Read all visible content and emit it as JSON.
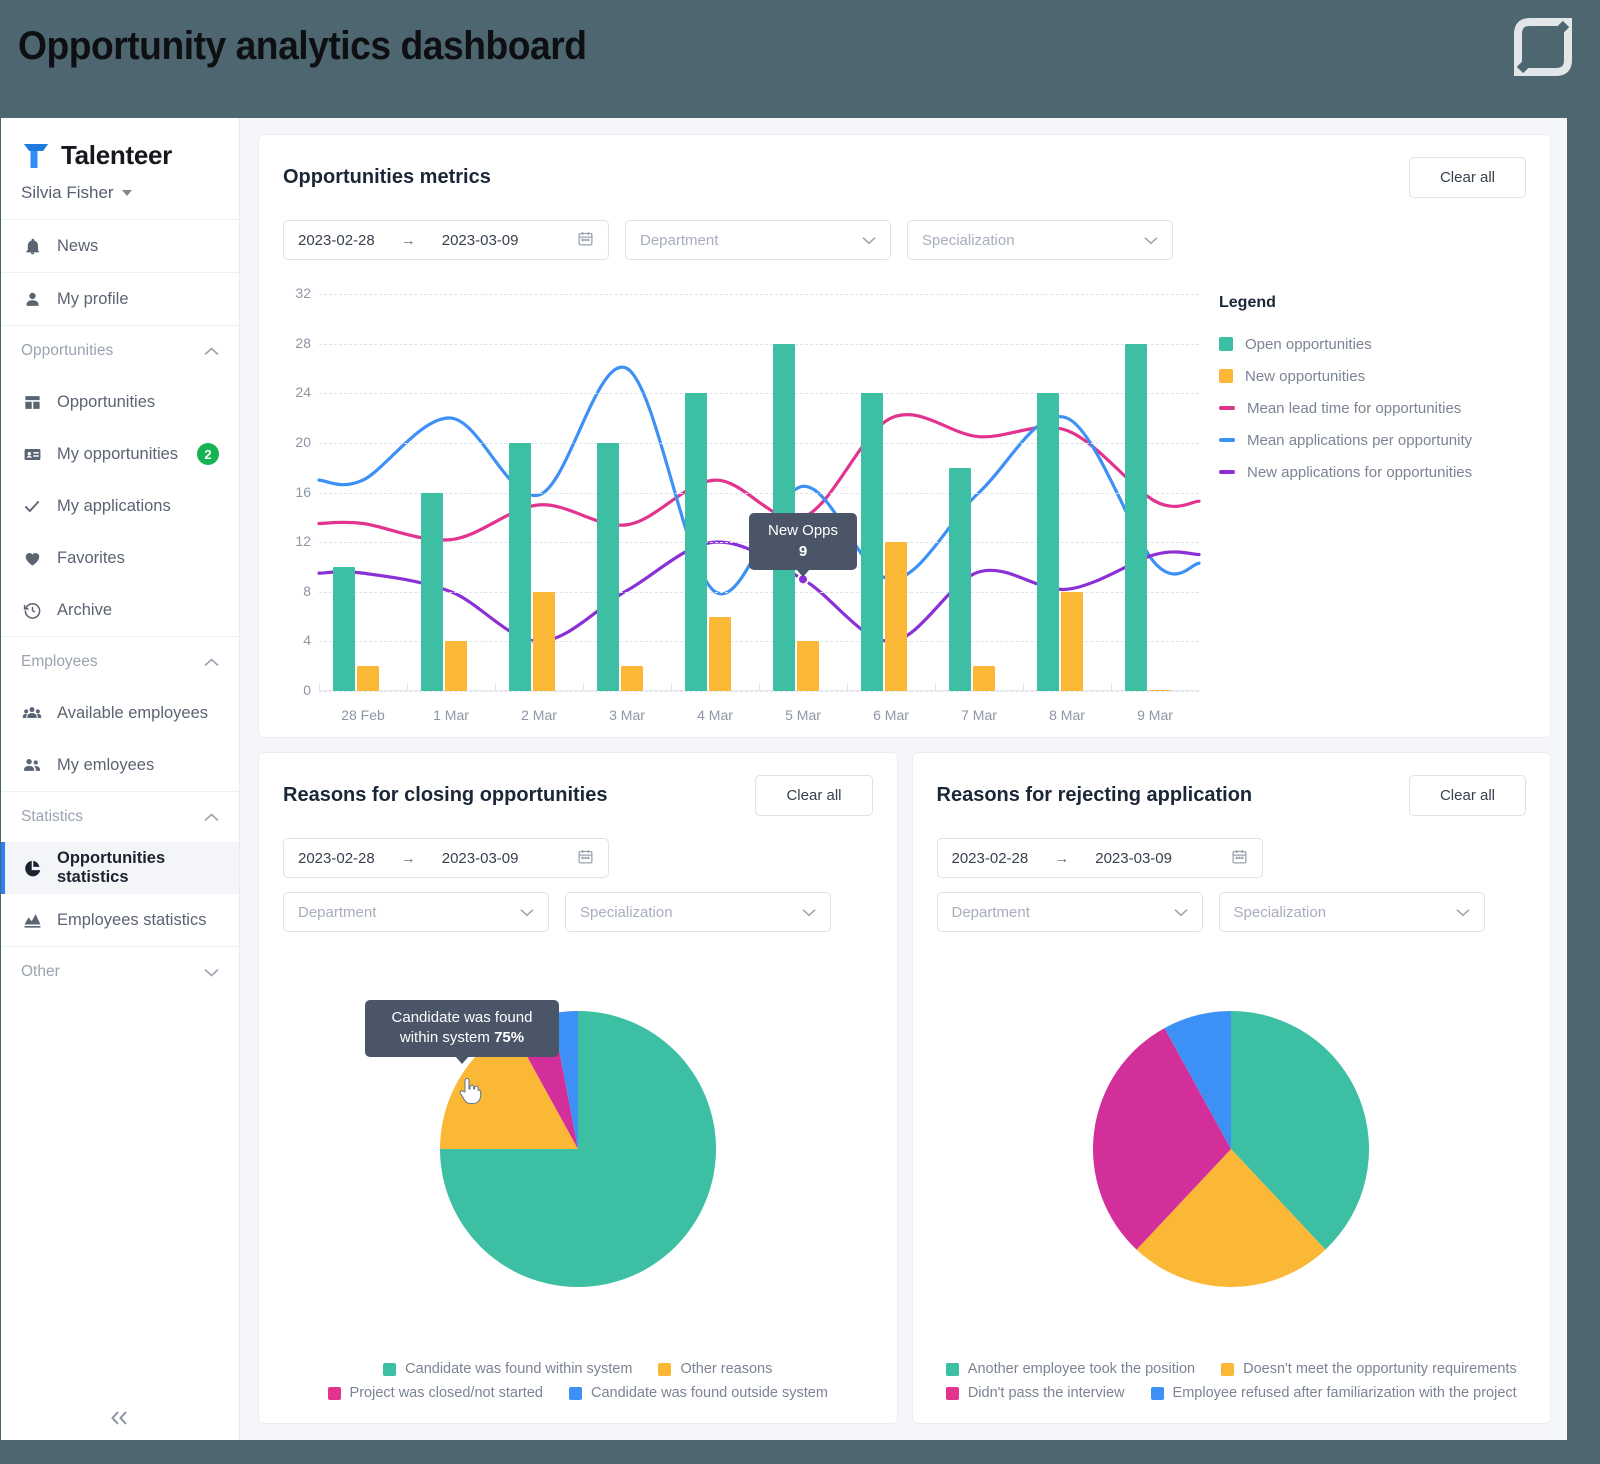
{
  "banner": {
    "title": "Opportunity analytics dashboard",
    "logo_icon": "leaf-logo-icon",
    "bg_color": "#4d6670"
  },
  "sidebar": {
    "brand": {
      "name": "Talenteer",
      "mark_icon": "talenteer-t-logo-icon",
      "mark_color": "#2d8cf5"
    },
    "user": {
      "name": "Silvia Fisher",
      "caret_icon": "caret-down-icon"
    },
    "top_items": [
      {
        "label": "News",
        "icon": "bell-icon"
      },
      {
        "label": "My profile",
        "icon": "person-icon"
      }
    ],
    "groups": [
      {
        "label": "Opportunities",
        "chevron": "chevron-up-icon",
        "items": [
          {
            "label": "Opportunities",
            "icon": "grid-table-icon",
            "badge": ""
          },
          {
            "label": "My opportunities",
            "icon": "id-card-icon",
            "badge": "2"
          },
          {
            "label": "My applications",
            "icon": "check-icon",
            "badge": ""
          },
          {
            "label": "Favorites",
            "icon": "heart-icon",
            "badge": ""
          },
          {
            "label": "Archive",
            "icon": "history-clock-icon",
            "badge": ""
          }
        ]
      },
      {
        "label": "Employees",
        "chevron": "chevron-up-icon",
        "items": [
          {
            "label": "Available employees",
            "icon": "people-group-icon",
            "badge": ""
          },
          {
            "label": "My emloyees",
            "icon": "two-people-icon",
            "badge": ""
          }
        ]
      },
      {
        "label": "Statistics",
        "chevron": "chevron-up-icon",
        "items": [
          {
            "label": "Opportunities statistics",
            "icon": "pie-chart-icon",
            "badge": "",
            "active": true
          },
          {
            "label": "Employees statistics",
            "icon": "area-chart-icon",
            "badge": ""
          }
        ]
      }
    ],
    "other_group": {
      "label": "Other",
      "chevron": "chevron-down-icon"
    },
    "collapse_icon": "double-chevron-left-icon",
    "badge_color": "#16b352",
    "active_marker_color": "#2d7ff9"
  },
  "metrics_card": {
    "title": "Opportunities metrics",
    "clear_label": "Clear all",
    "date_from": "2023-02-28",
    "date_to": "2023-03-09",
    "date_arrow": "→",
    "calendar_icon": "calendar-icon",
    "department_placeholder": "Department",
    "specialization_placeholder": "Specialization",
    "chevron_icon": "chevron-down-icon",
    "legend_title": "Legend",
    "tooltip": {
      "label": "New Opps",
      "value": "9"
    }
  },
  "closing_card": {
    "title": "Reasons for closing opportunities",
    "clear_label": "Clear all",
    "date_from": "2023-02-28",
    "date_to": "2023-03-09",
    "date_arrow": "→",
    "calendar_icon": "calendar-icon",
    "department_placeholder": "Department",
    "specialization_placeholder": "Specialization",
    "tooltip": {
      "text": "Candidate was found within system",
      "value": "75%"
    },
    "cursor_icon": "pointing-hand-cursor-icon"
  },
  "rejecting_card": {
    "title": "Reasons for rejecting application",
    "clear_label": "Clear all",
    "date_from": "2023-02-28",
    "date_to": "2023-03-09",
    "date_arrow": "→",
    "calendar_icon": "calendar-icon",
    "department_placeholder": "Department",
    "specialization_placeholder": "Specialization"
  },
  "colors": {
    "teal": "#3cbfa2",
    "orange": "#fbb736",
    "pink": "#e2338f",
    "blue": "#3d90f5",
    "purple": "#8b2fd6",
    "magenta": "#d32f9a",
    "tooltip_bg": "#4a5567"
  },
  "chart_data": [
    {
      "id": "opportunities-metrics",
      "type": "bar",
      "title": "Opportunities metrics",
      "xlabel": "",
      "ylabel": "",
      "ylim": [
        0,
        32
      ],
      "yticks": [
        0,
        4,
        8,
        12,
        16,
        20,
        24,
        28,
        32
      ],
      "grid": true,
      "legend_position": "right",
      "categories": [
        "28 Feb",
        "1 Mar",
        "2 Mar",
        "3 Mar",
        "4 Mar",
        "5 Mar",
        "6 Mar",
        "7 Mar",
        "8 Mar",
        "9 Mar"
      ],
      "series": [
        {
          "name": "Open opportunities",
          "type": "bar",
          "color": "#3cbfa2",
          "values": [
            10,
            16,
            20,
            20,
            24,
            28,
            24,
            18,
            24,
            28
          ]
        },
        {
          "name": "New opportunities",
          "type": "bar",
          "color": "#fbb736",
          "values": [
            2,
            4,
            8,
            2,
            6,
            4,
            12,
            2,
            8,
            0
          ]
        },
        {
          "name": "Mean lead time for opportunities",
          "type": "line",
          "color": "#e2338f",
          "values": [
            13.5,
            12.2,
            15,
            13.4,
            17,
            14,
            22,
            20.5,
            21,
            15.3
          ]
        },
        {
          "name": "Mean applications per opportunity",
          "type": "line",
          "color": "#3d90f5",
          "values": [
            17,
            22,
            15.8,
            26,
            8,
            16.5,
            9,
            16,
            22,
            10.3
          ]
        },
        {
          "name": "New applications for opportunities",
          "type": "line",
          "color": "#8b2fd6",
          "values": [
            9.5,
            8,
            4,
            8.1,
            12,
            9,
            4,
            9.6,
            8.2,
            11
          ]
        }
      ],
      "annotations": [
        {
          "label": "New Opps",
          "value": "9",
          "series": "New applications for opportunities",
          "x": "5 Mar"
        }
      ]
    },
    {
      "id": "reasons-for-closing-opportunities",
      "type": "pie",
      "title": "Reasons for closing opportunities",
      "legend_position": "bottom",
      "labels": [
        "Candidate was found within system",
        "Other reasons",
        "Project was closed/not started",
        "Candidate was found outside system"
      ],
      "values": [
        75,
        17,
        5,
        3
      ],
      "colors": [
        "#3cbfa2",
        "#fbb736",
        "#d32f9a",
        "#3d90f5"
      ],
      "annotations": [
        {
          "label": "Candidate was found within system",
          "value": "75%"
        }
      ]
    },
    {
      "id": "reasons-for-rejecting-application",
      "type": "pie",
      "title": "Reasons for rejecting application",
      "legend_position": "bottom",
      "labels": [
        "Another employee took the position",
        "Doesn't meet the opportunity requirements",
        "Didn't pass the interview",
        "Employee refused after familiarization with the project"
      ],
      "values": [
        38,
        24,
        30,
        8
      ],
      "colors": [
        "#3cbfa2",
        "#fbb736",
        "#d32f9a",
        "#3d90f5"
      ]
    }
  ],
  "pie_legend_closing": [
    {
      "label": "Candidate was found within system",
      "color": "#3cbfa2"
    },
    {
      "label": "Other reasons",
      "color": "#fbb736"
    },
    {
      "label": "Project was closed/not started",
      "color": "#e2338f"
    },
    {
      "label": "Candidate was found outside system",
      "color": "#3d90f5"
    }
  ],
  "pie_legend_rejecting": [
    {
      "label": "Another employee took the position",
      "color": "#3cbfa2"
    },
    {
      "label": "Doesn't meet the opportunity requirements",
      "color": "#fbb736"
    },
    {
      "label": "Didn't pass the interview",
      "color": "#e2338f"
    },
    {
      "label": "Employee refused after familiarization with the project",
      "color": "#3d90f5"
    }
  ]
}
